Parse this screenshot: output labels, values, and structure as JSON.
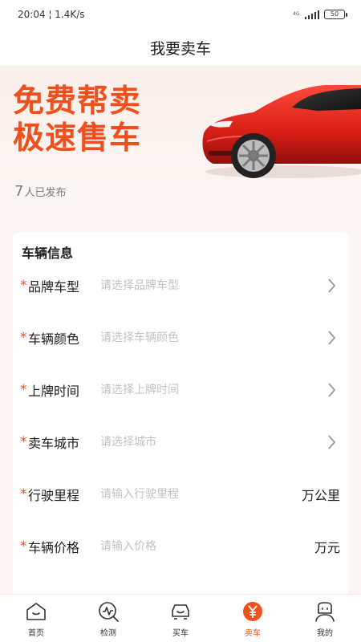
{
  "status_bar": {
    "time_speed": "20:04 ¦ 1.4K/s",
    "network": "4G",
    "battery": "50"
  },
  "header": {
    "title": "我要卖车"
  },
  "banner": {
    "slogan_line1": "免费帮卖",
    "slogan_line2": "极速售车",
    "publish_count": "7",
    "publish_suffix": "人已发布"
  },
  "form": {
    "section_title": "车辆信息",
    "required_mark": "*",
    "fields": [
      {
        "label": "品牌车型",
        "placeholder": "请选择品牌车型",
        "value": "",
        "kind": "select"
      },
      {
        "label": "车辆颜色",
        "placeholder": "请选择车辆颜色",
        "value": "",
        "kind": "select"
      },
      {
        "label": "上牌时间",
        "placeholder": "请选择上牌时间",
        "value": "",
        "kind": "select"
      },
      {
        "label": "卖车城市",
        "placeholder": "请选择城市",
        "value": "",
        "kind": "select"
      },
      {
        "label": "行驶里程",
        "placeholder": "请输入行驶里程",
        "value": "",
        "kind": "input",
        "unit": "万公里"
      },
      {
        "label": "车辆价格",
        "placeholder": "请输入价格",
        "value": "",
        "kind": "input",
        "unit": "万元"
      }
    ]
  },
  "nav": {
    "items": [
      {
        "label": "首页",
        "icon": "home-icon"
      },
      {
        "label": "检测",
        "icon": "inspect-icon"
      },
      {
        "label": "买车",
        "icon": "buy-car-icon"
      },
      {
        "label": "卖车",
        "icon": "sell-car-icon",
        "active": true
      },
      {
        "label": "我的",
        "icon": "profile-icon"
      }
    ]
  },
  "colors": {
    "accent": "#f0501e",
    "text": "#1c1c1c",
    "placeholder": "#c2c2c2"
  }
}
